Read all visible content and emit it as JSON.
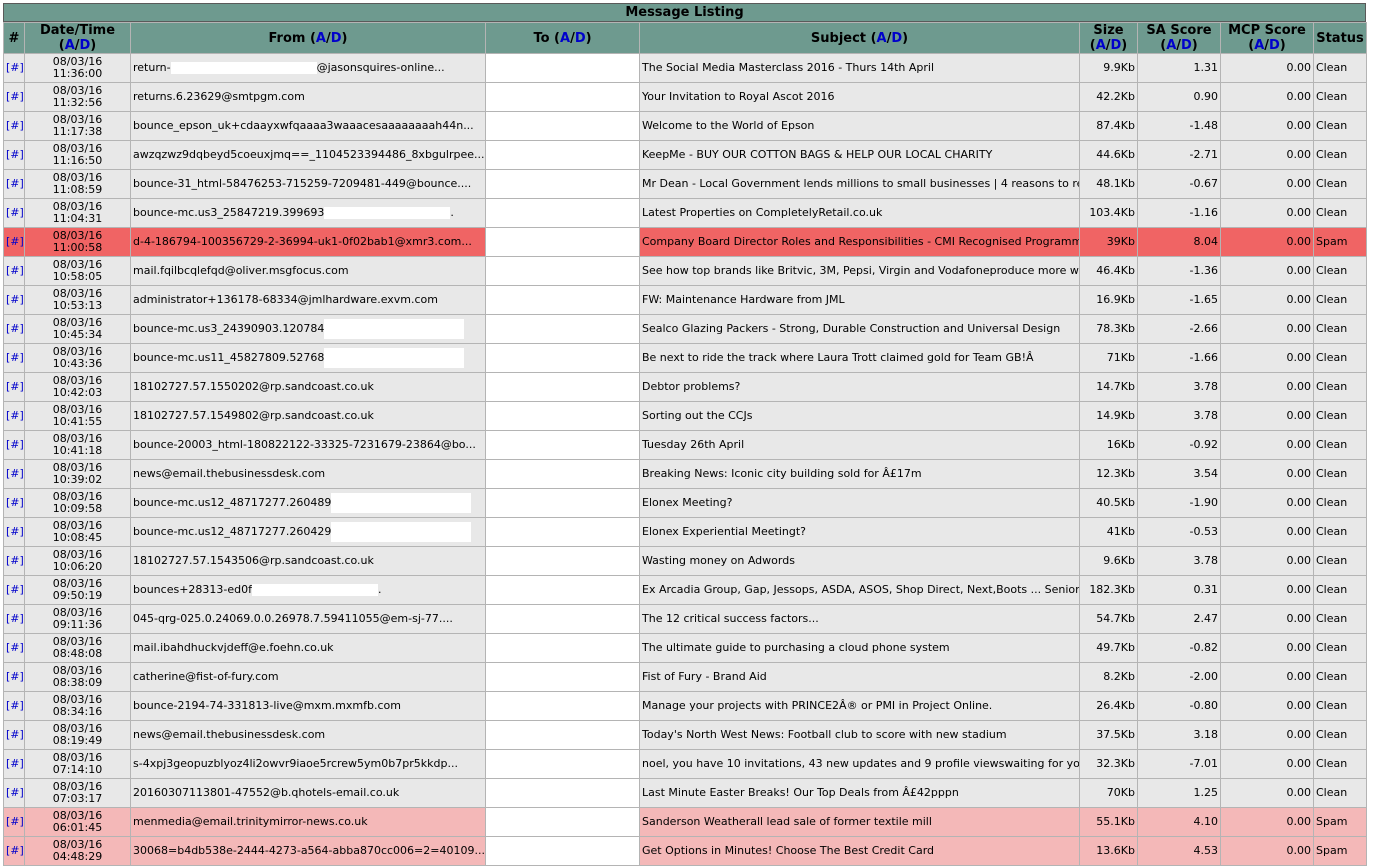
{
  "caption": "Message Listing",
  "columns": {
    "hash": "#",
    "datetime": "Date/Time",
    "from": "From",
    "to": "To",
    "subject": "Subject",
    "size": "Size",
    "sa": "SA Score",
    "mcp": "MCP Score",
    "status": "Status",
    "sort_a": "A",
    "sort_d": "D",
    "sep": "/",
    "open": "(",
    "close": ")"
  },
  "row_link": "[#]",
  "rows": [
    {
      "date": "08/03/16",
      "time": "11:36:00",
      "from": "return-",
      "from_suffix": "@jasonsquires-online...",
      "redact": 1,
      "subject": "The Social Media Masterclass 2016 - Thurs 14th April",
      "size": "9.9Kb",
      "sa": "1.31",
      "mcp": "0.00",
      "status": "Clean",
      "kind": "clean"
    },
    {
      "date": "08/03/16",
      "time": "11:32:56",
      "from": "returns.6.23629@smtpgm.com",
      "from_suffix": "",
      "redact": 0,
      "subject": "Your Invitation to Royal Ascot 2016",
      "size": "42.2Kb",
      "sa": "0.90",
      "mcp": "0.00",
      "status": "Clean",
      "kind": "clean"
    },
    {
      "date": "08/03/16",
      "time": "11:17:38",
      "from": "bounce_epson_uk+cdaayxwfqaaaa3waaacesaaaaaaaah44n...",
      "from_suffix": "",
      "redact": 0,
      "subject": "Welcome to the World of Epson",
      "size": "87.4Kb",
      "sa": "-1.48",
      "mcp": "0.00",
      "status": "Clean",
      "kind": "clean"
    },
    {
      "date": "08/03/16",
      "time": "11:16:50",
      "from": "awzqzwz9dqbeyd5coeuxjmq==_1104523394486_8xbgulrpee...",
      "from_suffix": "",
      "redact": 0,
      "subject": "KeepMe - BUY OUR COTTON BAGS & HELP OUR LOCAL CHARITY",
      "size": "44.6Kb",
      "sa": "-2.71",
      "mcp": "0.00",
      "status": "Clean",
      "kind": "clean"
    },
    {
      "date": "08/03/16",
      "time": "11:08:59",
      "from": "bounce-31_html-58476253-715259-7209481-449@bounce....",
      "from_suffix": "",
      "redact": 0,
      "subject": "Mr Dean - Local Government lends millions to small businesses | 4 reasons to refinance",
      "size": "48.1Kb",
      "sa": "-0.67",
      "mcp": "0.00",
      "status": "Clean",
      "kind": "clean"
    },
    {
      "date": "08/03/16",
      "time": "11:04:31",
      "from": "bounce-mc.us3_25847219.399693",
      "from_suffix": ".",
      "redact": 2,
      "subject": "Latest Properties on CompletelyRetail.co.uk",
      "size": "103.4Kb",
      "sa": "-1.16",
      "mcp": "0.00",
      "status": "Clean",
      "kind": "clean"
    },
    {
      "date": "08/03/16",
      "time": "11:00:58",
      "from": "d-4-186794-100356729-2-36994-uk1-0f02bab1@xmr3.com...",
      "from_suffix": "",
      "redact": 0,
      "subject": "Company Board Director Roles and Responsibilities - CMI Recognised Programme â Excellence in Learning",
      "size": "39Kb",
      "sa": "8.04",
      "mcp": "0.00",
      "status": "Spam",
      "kind": "spam"
    },
    {
      "date": "08/03/16",
      "time": "10:58:05",
      "from": "mail.fqilbcqlefqd@oliver.msgfocus.com",
      "from_suffix": "",
      "redact": 0,
      "subject": "See how top brands like Britvic, 3M, Pepsi, Virgin and Vodafoneproduce more work, faster and more cost-effectively",
      "size": "46.4Kb",
      "sa": "-1.36",
      "mcp": "0.00",
      "status": "Clean",
      "kind": "clean"
    },
    {
      "date": "08/03/16",
      "time": "10:53:13",
      "from": "administrator+136178-68334@jmlhardware.exvm.com",
      "from_suffix": "",
      "redact": 0,
      "subject": "FW: Maintenance Hardware from JML",
      "size": "16.9Kb",
      "sa": "-1.65",
      "mcp": "0.00",
      "status": "Clean",
      "kind": "clean"
    },
    {
      "date": "08/03/16",
      "time": "10:45:34",
      "from": "bounce-mc.us3_24390903.120784",
      "from_suffix": "",
      "redact": 3,
      "subject": "Sealco Glazing Packers - Strong, Durable Construction and Universal Design",
      "size": "78.3Kb",
      "sa": "-2.66",
      "mcp": "0.00",
      "status": "Clean",
      "kind": "clean"
    },
    {
      "date": "08/03/16",
      "time": "10:43:36",
      "from": "bounce-mc.us11_45827809.52768",
      "from_suffix": "",
      "redact": 3,
      "subject": "Be next to ride the track where Laura Trott claimed gold for Team GB!Â",
      "size": "71Kb",
      "sa": "-1.66",
      "mcp": "0.00",
      "status": "Clean",
      "kind": "clean"
    },
    {
      "date": "08/03/16",
      "time": "10:42:03",
      "from": "18102727.57.1550202@rp.sandcoast.co.uk",
      "from_suffix": "",
      "redact": 0,
      "subject": "Debtor problems?",
      "size": "14.7Kb",
      "sa": "3.78",
      "mcp": "0.00",
      "status": "Clean",
      "kind": "clean"
    },
    {
      "date": "08/03/16",
      "time": "10:41:55",
      "from": "18102727.57.1549802@rp.sandcoast.co.uk",
      "from_suffix": "",
      "redact": 0,
      "subject": "Sorting out the CCJs",
      "size": "14.9Kb",
      "sa": "3.78",
      "mcp": "0.00",
      "status": "Clean",
      "kind": "clean"
    },
    {
      "date": "08/03/16",
      "time": "10:41:18",
      "from": "bounce-20003_html-180822122-33325-7231679-23864@bo...",
      "from_suffix": "",
      "redact": 0,
      "subject": "Tuesday 26th April",
      "size": "16Kb",
      "sa": "-0.92",
      "mcp": "0.00",
      "status": "Clean",
      "kind": "clean"
    },
    {
      "date": "08/03/16",
      "time": "10:39:02",
      "from": "news@email.thebusinessdesk.com",
      "from_suffix": "",
      "redact": 0,
      "subject": "Breaking News: Iconic city building sold for Â£17m",
      "size": "12.3Kb",
      "sa": "3.54",
      "mcp": "0.00",
      "status": "Clean",
      "kind": "clean"
    },
    {
      "date": "08/03/16",
      "time": "10:09:58",
      "from": "bounce-mc.us12_48717277.260489",
      "from_suffix": "",
      "redact": 3,
      "subject": "Elonex Meeting?",
      "size": "40.5Kb",
      "sa": "-1.90",
      "mcp": "0.00",
      "status": "Clean",
      "kind": "clean"
    },
    {
      "date": "08/03/16",
      "time": "10:08:45",
      "from": "bounce-mc.us12_48717277.260429",
      "from_suffix": "",
      "redact": 3,
      "subject": "Elonex Experiential Meetingt?",
      "size": "41Kb",
      "sa": "-0.53",
      "mcp": "0.00",
      "status": "Clean",
      "kind": "clean"
    },
    {
      "date": "08/03/16",
      "time": "10:06:20",
      "from": "18102727.57.1543506@rp.sandcoast.co.uk",
      "from_suffix": "",
      "redact": 0,
      "subject": "Wasting money on Adwords",
      "size": "9.6Kb",
      "sa": "3.78",
      "mcp": "0.00",
      "status": "Clean",
      "kind": "clean"
    },
    {
      "date": "08/03/16",
      "time": "09:50:19",
      "from": "bounces+28313-ed0f",
      "from_suffix": ".",
      "redact": 2,
      "subject": "Ex Arcadia Group, Gap, Jessops, ASDA, ASOS, Shop Direct, Next,Boots ... Senior Retail Professionals",
      "size": "182.3Kb",
      "sa": "0.31",
      "mcp": "0.00",
      "status": "Clean",
      "kind": "clean"
    },
    {
      "date": "08/03/16",
      "time": "09:11:36",
      "from": "045-qrg-025.0.24069.0.0.26978.7.59411055@em-sj-77....",
      "from_suffix": "",
      "redact": 0,
      "subject": "The 12 critical success factors...",
      "size": "54.7Kb",
      "sa": "2.47",
      "mcp": "0.00",
      "status": "Clean",
      "kind": "clean"
    },
    {
      "date": "08/03/16",
      "time": "08:48:08",
      "from": "mail.ibahdhuckvjdeff@e.foehn.co.uk",
      "from_suffix": "",
      "redact": 0,
      "subject": "The ultimate guide to purchasing a cloud phone system",
      "size": "49.7Kb",
      "sa": "-0.82",
      "mcp": "0.00",
      "status": "Clean",
      "kind": "clean"
    },
    {
      "date": "08/03/16",
      "time": "08:38:09",
      "from": "catherine@fist-of-fury.com",
      "from_suffix": "",
      "redact": 0,
      "subject": "Fist of Fury - Brand Aid",
      "size": "8.2Kb",
      "sa": "-2.00",
      "mcp": "0.00",
      "status": "Clean",
      "kind": "clean"
    },
    {
      "date": "08/03/16",
      "time": "08:34:16",
      "from": "bounce-2194-74-331813-live@mxm.mxmfb.com",
      "from_suffix": "",
      "redact": 0,
      "subject": "Manage your projects with PRINCE2Â® or PMI in Project Online.",
      "size": "26.4Kb",
      "sa": "-0.80",
      "mcp": "0.00",
      "status": "Clean",
      "kind": "clean"
    },
    {
      "date": "08/03/16",
      "time": "08:19:49",
      "from": "news@email.thebusinessdesk.com",
      "from_suffix": "",
      "redact": 0,
      "subject": "Today's North West News: Football club to score with new stadium",
      "size": "37.5Kb",
      "sa": "3.18",
      "mcp": "0.00",
      "status": "Clean",
      "kind": "clean"
    },
    {
      "date": "08/03/16",
      "time": "07:14:10",
      "from": "s-4xpj3geopuzblyoz4li2owvr9iaoe5rcrew5ym0b7pr5kkdp...",
      "from_suffix": "",
      "redact": 0,
      "subject": "noel, you have 10 invitations, 43 new updates and 9 profile viewswaiting for you on LinkedIn",
      "size": "32.3Kb",
      "sa": "-7.01",
      "mcp": "0.00",
      "status": "Clean",
      "kind": "clean"
    },
    {
      "date": "08/03/16",
      "time": "07:03:17",
      "from": "20160307113801-47552@b.qhotels-email.co.uk",
      "from_suffix": "",
      "redact": 0,
      "subject": "Last Minute Easter Breaks! Our Top Deals from Â£42pppn",
      "size": "70Kb",
      "sa": "1.25",
      "mcp": "0.00",
      "status": "Clean",
      "kind": "clean"
    },
    {
      "date": "08/03/16",
      "time": "06:01:45",
      "from": "menmedia@email.trinitymirror-news.co.uk",
      "from_suffix": "",
      "redact": 0,
      "subject": "Sanderson Weatherall lead sale of former textile mill",
      "size": "55.1Kb",
      "sa": "4.10",
      "mcp": "0.00",
      "status": "Spam",
      "kind": "spam-light"
    },
    {
      "date": "08/03/16",
      "time": "04:48:29",
      "from": "30068=b4db538e-2444-4273-a564-abba870cc006=2=40109...",
      "from_suffix": "",
      "redact": 0,
      "subject": "Get Options in Minutes! Choose The Best Credit Card",
      "size": "13.6Kb",
      "sa": "4.53",
      "mcp": "0.00",
      "status": "Spam",
      "kind": "spam-light"
    }
  ]
}
